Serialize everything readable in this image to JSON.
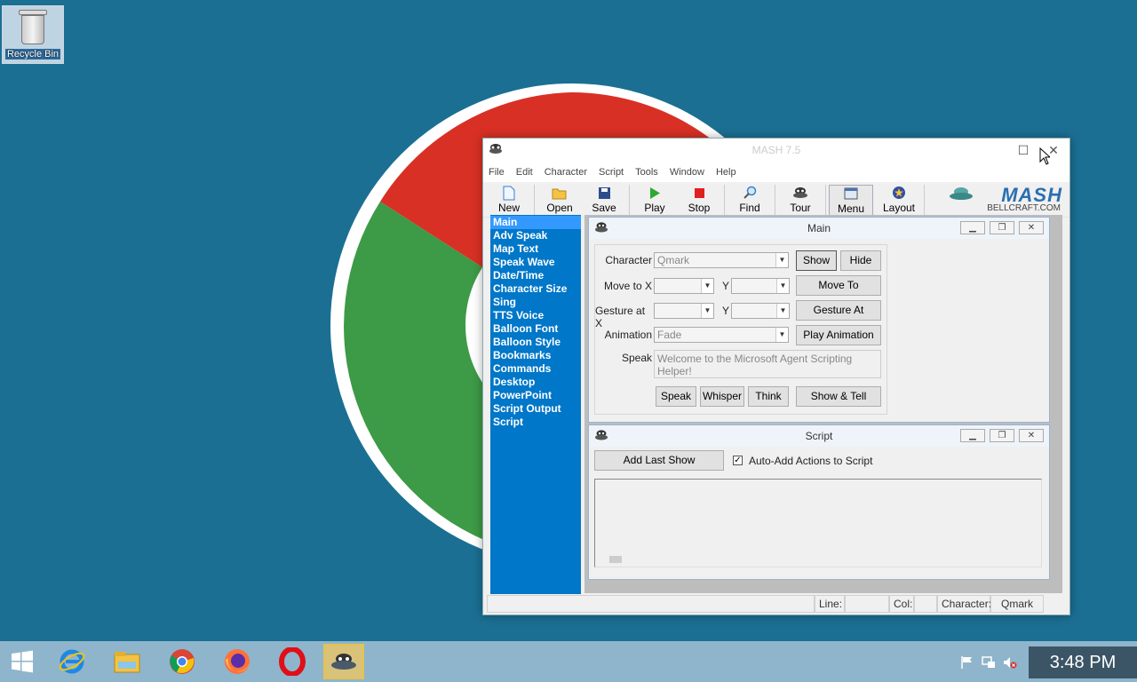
{
  "desktop": {
    "recycle_bin_label": "Recycle Bin"
  },
  "window": {
    "title": "MASH 7.5",
    "menu": [
      "File",
      "Edit",
      "Character",
      "Script",
      "Tools",
      "Window",
      "Help"
    ],
    "toolbar": [
      {
        "label": "New",
        "icon": "new-document-icon"
      },
      {
        "label": "Open",
        "icon": "folder-open-icon"
      },
      {
        "label": "Save",
        "icon": "save-disk-icon"
      },
      {
        "label": "Play",
        "icon": "play-triangle-icon"
      },
      {
        "label": "Stop",
        "icon": "stop-square-icon"
      },
      {
        "label": "Find",
        "icon": "magnifier-icon"
      },
      {
        "label": "Tour",
        "icon": "agent-character-icon"
      },
      {
        "label": "Menu",
        "icon": "menu-window-icon"
      },
      {
        "label": "Layout",
        "icon": "layout-star-icon"
      }
    ],
    "logo": {
      "text": "MASH",
      "subtext": "BELLCRAFT.COM"
    },
    "nav_items": [
      "Main",
      "Adv Speak",
      "Map Text",
      "Speak Wave",
      "Date/Time",
      "Character Size",
      "Sing",
      "TTS Voice",
      "Balloon Font",
      "Balloon Style",
      "Bookmarks",
      "Commands",
      "Desktop",
      "PowerPoint",
      "Script Output",
      "Script"
    ],
    "main_panel": {
      "title": "Main",
      "character_label": "Character",
      "character_value": "Qmark",
      "show_label": "Show",
      "hide_label": "Hide",
      "move_to_x_label": "Move to X",
      "y_label": "Y",
      "move_to_label": "Move To",
      "gesture_at_x_label": "Gesture at X",
      "gesture_at_label": "Gesture At",
      "animation_label": "Animation",
      "animation_value": "Fade",
      "play_animation_label": "Play Animation",
      "speak_label": "Speak",
      "speak_text": "Welcome to the Microsoft Agent Scripting Helper!",
      "speak_btn": "Speak",
      "whisper_btn": "Whisper",
      "think_btn": "Think",
      "show_tell_btn": "Show & Tell"
    },
    "script_panel": {
      "title": "Script",
      "add_last_show": "Add Last Show",
      "auto_add_label": "Auto-Add Actions to Script",
      "auto_add_checked": true
    },
    "status": {
      "line_label": "Line:",
      "col_label": "Col:",
      "character_label": "Character:",
      "character_value": "Qmark"
    }
  },
  "taskbar": {
    "clock": "3:48 PM",
    "apps": [
      "start-icon",
      "internet-explorer-icon",
      "file-explorer-icon",
      "chrome-icon",
      "firefox-icon",
      "opera-icon",
      "mash-icon"
    ]
  },
  "colors": {
    "nav_bg": "#0077c8",
    "nav_selected": "#3399ff",
    "taskbar": "#8fb5cc",
    "desktop": "#1b6f93"
  }
}
